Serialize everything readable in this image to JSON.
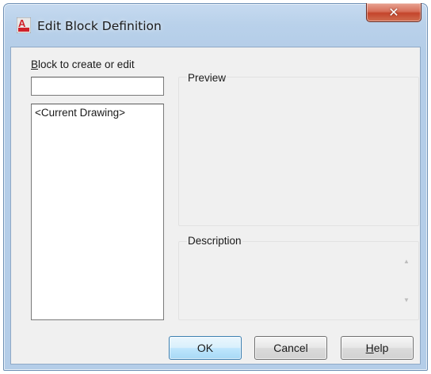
{
  "window": {
    "title": "Edit Block Definition",
    "app_icon": "autocad-a-icon",
    "close_glyph": "✕"
  },
  "colors": {
    "frame": "#b9d1ea",
    "client_bg": "#f0f0f0",
    "close_button": "#c4452c",
    "app_icon_red": "#d0202a"
  },
  "block_section": {
    "label_accel": "B",
    "label_rest": "lock to create or edit",
    "input_value": "",
    "list_items": [
      "<Current Drawing>"
    ]
  },
  "preview": {
    "label": "Preview"
  },
  "description": {
    "label": "Description",
    "scroll_up_glyph": "▲",
    "scroll_down_glyph": "▼"
  },
  "buttons": {
    "ok_label": "OK",
    "cancel_label": "Cancel",
    "help_accel": "H",
    "help_rest": "elp"
  }
}
